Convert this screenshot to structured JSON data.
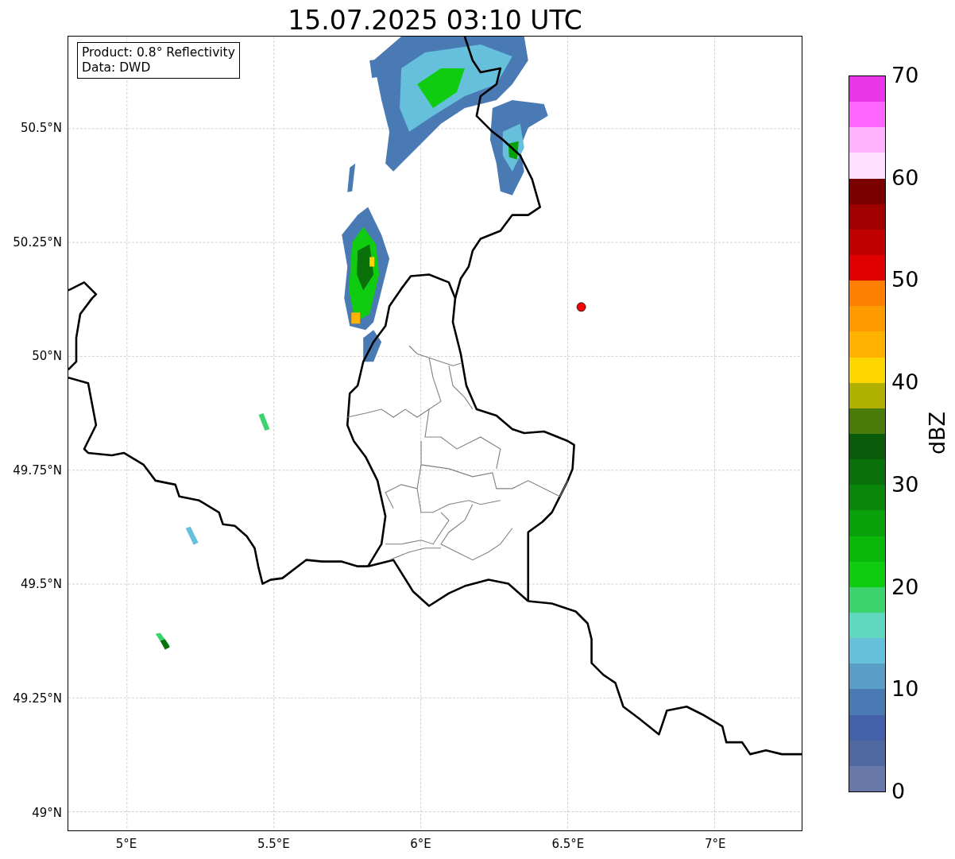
{
  "title": "15.07.2025 03:10 UTC",
  "info_box": {
    "lines": [
      "Product: 0.8° Reflectivity",
      "Data: DWD"
    ]
  },
  "map": {
    "lat_ticks": [
      "50.5°N",
      "50.25°N",
      "50°N",
      "49.75°N",
      "49.5°N",
      "49.25°N",
      "49°N"
    ],
    "lon_ticks": [
      "5°E",
      "5.5°E",
      "6°E",
      "6.5°E",
      "7°E"
    ]
  },
  "colorbar": {
    "label": "dBZ",
    "ticks": [
      "70",
      "60",
      "50",
      "40",
      "30",
      "20",
      "10",
      "0"
    ],
    "bins": [
      {
        "color": "#6878a8"
      },
      {
        "color": "#5068a0"
      },
      {
        "color": "#4460a8"
      },
      {
        "color": "#4a7ab4"
      },
      {
        "color": "#5a9ec8"
      },
      {
        "color": "#66c0dc"
      },
      {
        "color": "#60d8c0"
      },
      {
        "color": "#3dd46e"
      },
      {
        "color": "#10cc10"
      },
      {
        "color": "#0ab80a"
      },
      {
        "color": "#0aa00a"
      },
      {
        "color": "#0a860a"
      },
      {
        "color": "#0a700a"
      },
      {
        "color": "#0a5c0a"
      },
      {
        "color": "#4a7a0a"
      },
      {
        "color": "#b0b000"
      },
      {
        "color": "#ffd700"
      },
      {
        "color": "#ffb300"
      },
      {
        "color": "#ff9900"
      },
      {
        "color": "#ff7f00"
      },
      {
        "color": "#e00000"
      },
      {
        "color": "#c00000"
      },
      {
        "color": "#a00000"
      },
      {
        "color": "#7a0000"
      },
      {
        "color": "#ffdfff"
      },
      {
        "color": "#ffb3ff"
      },
      {
        "color": "#ff66ff"
      },
      {
        "color": "#e936e9"
      }
    ]
  }
}
